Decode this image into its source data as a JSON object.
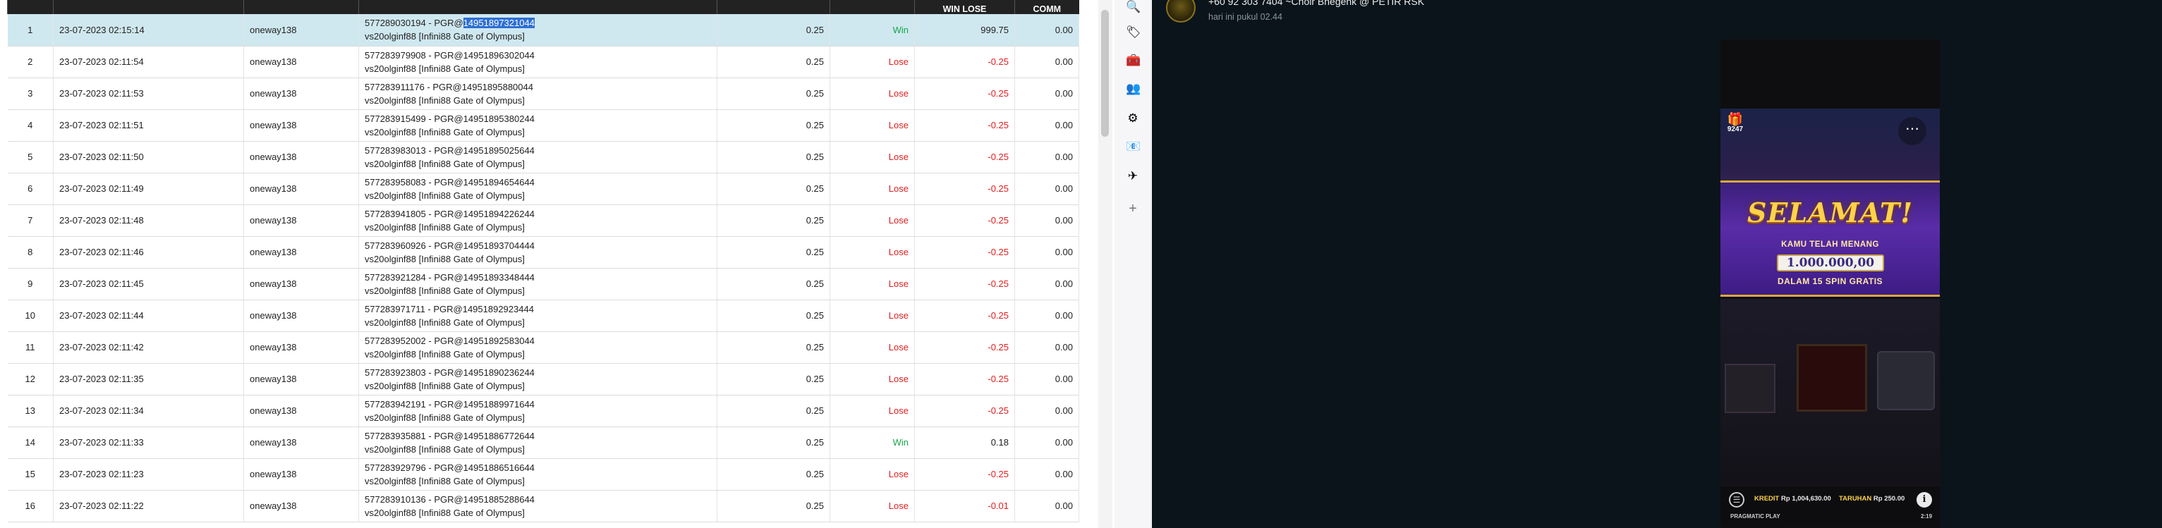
{
  "table": {
    "headers": [
      "",
      "",
      "",
      "",
      "",
      "",
      "WIN LOSE",
      "COMM"
    ],
    "rows": [
      {
        "no": "1",
        "date": "23-07-2023 02:15:14",
        "user": "oneway138",
        "detail_prefix": "577289030194 - PGR@",
        "detail_highlight": "14951897321044",
        "detail_line2": "vs20olginf88 [Infini88 Gate of Olympus]",
        "stake": "0.25",
        "status": "Win",
        "win_lose": "999.75",
        "comm": "0.00"
      },
      {
        "no": "2",
        "date": "23-07-2023 02:11:54",
        "user": "oneway138",
        "detail_prefix": "577283979908 - PGR@14951896302044",
        "detail_highlight": "",
        "detail_line2": "vs20olginf88 [Infini88 Gate of Olympus]",
        "stake": "0.25",
        "status": "Lose",
        "win_lose": "-0.25",
        "comm": "0.00"
      },
      {
        "no": "3",
        "date": "23-07-2023 02:11:53",
        "user": "oneway138",
        "detail_prefix": "577283911176 - PGR@14951895880044",
        "detail_highlight": "",
        "detail_line2": "vs20olginf88 [Infini88 Gate of Olympus]",
        "stake": "0.25",
        "status": "Lose",
        "win_lose": "-0.25",
        "comm": "0.00"
      },
      {
        "no": "4",
        "date": "23-07-2023 02:11:51",
        "user": "oneway138",
        "detail_prefix": "577283915499 - PGR@14951895380244",
        "detail_highlight": "",
        "detail_line2": "vs20olginf88 [Infini88 Gate of Olympus]",
        "stake": "0.25",
        "status": "Lose",
        "win_lose": "-0.25",
        "comm": "0.00"
      },
      {
        "no": "5",
        "date": "23-07-2023 02:11:50",
        "user": "oneway138",
        "detail_prefix": "577283983013 - PGR@14951895025644",
        "detail_highlight": "",
        "detail_line2": "vs20olginf88 [Infini88 Gate of Olympus]",
        "stake": "0.25",
        "status": "Lose",
        "win_lose": "-0.25",
        "comm": "0.00"
      },
      {
        "no": "6",
        "date": "23-07-2023 02:11:49",
        "user": "oneway138",
        "detail_prefix": "577283958083 - PGR@14951894654644",
        "detail_highlight": "",
        "detail_line2": "vs20olginf88 [Infini88 Gate of Olympus]",
        "stake": "0.25",
        "status": "Lose",
        "win_lose": "-0.25",
        "comm": "0.00"
      },
      {
        "no": "7",
        "date": "23-07-2023 02:11:48",
        "user": "oneway138",
        "detail_prefix": "577283941805 - PGR@14951894226244",
        "detail_highlight": "",
        "detail_line2": "vs20olginf88 [Infini88 Gate of Olympus]",
        "stake": "0.25",
        "status": "Lose",
        "win_lose": "-0.25",
        "comm": "0.00"
      },
      {
        "no": "8",
        "date": "23-07-2023 02:11:46",
        "user": "oneway138",
        "detail_prefix": "577283960926 - PGR@14951893704444",
        "detail_highlight": "",
        "detail_line2": "vs20olginf88 [Infini88 Gate of Olympus]",
        "stake": "0.25",
        "status": "Lose",
        "win_lose": "-0.25",
        "comm": "0.00"
      },
      {
        "no": "9",
        "date": "23-07-2023 02:11:45",
        "user": "oneway138",
        "detail_prefix": "577283921284 - PGR@14951893348444",
        "detail_highlight": "",
        "detail_line2": "vs20olginf88 [Infini88 Gate of Olympus]",
        "stake": "0.25",
        "status": "Lose",
        "win_lose": "-0.25",
        "comm": "0.00"
      },
      {
        "no": "10",
        "date": "23-07-2023 02:11:44",
        "user": "oneway138",
        "detail_prefix": "577283971711 - PGR@14951892923444",
        "detail_highlight": "",
        "detail_line2": "vs20olginf88 [Infini88 Gate of Olympus]",
        "stake": "0.25",
        "status": "Lose",
        "win_lose": "-0.25",
        "comm": "0.00"
      },
      {
        "no": "11",
        "date": "23-07-2023 02:11:42",
        "user": "oneway138",
        "detail_prefix": "577283952002 - PGR@14951892583044",
        "detail_highlight": "",
        "detail_line2": "vs20olginf88 [Infini88 Gate of Olympus]",
        "stake": "0.25",
        "status": "Lose",
        "win_lose": "-0.25",
        "comm": "0.00"
      },
      {
        "no": "12",
        "date": "23-07-2023 02:11:35",
        "user": "oneway138",
        "detail_prefix": "577283923803 - PGR@14951890236244",
        "detail_highlight": "",
        "detail_line2": "vs20olginf88 [Infini88 Gate of Olympus]",
        "stake": "0.25",
        "status": "Lose",
        "win_lose": "-0.25",
        "comm": "0.00"
      },
      {
        "no": "13",
        "date": "23-07-2023 02:11:34",
        "user": "oneway138",
        "detail_prefix": "577283942191 - PGR@14951889971644",
        "detail_highlight": "",
        "detail_line2": "vs20olginf88 [Infini88 Gate of Olympus]",
        "stake": "0.25",
        "status": "Lose",
        "win_lose": "-0.25",
        "comm": "0.00"
      },
      {
        "no": "14",
        "date": "23-07-2023 02:11:33",
        "user": "oneway138",
        "detail_prefix": "577283935881 - PGR@14951886772644",
        "detail_highlight": "",
        "detail_line2": "vs20olginf88 [Infini88 Gate of Olympus]",
        "stake": "0.25",
        "status": "Win",
        "win_lose": "0.18",
        "comm": "0.00"
      },
      {
        "no": "15",
        "date": "23-07-2023 02:11:23",
        "user": "oneway138",
        "detail_prefix": "577283929796 - PGR@14951886516644",
        "detail_highlight": "",
        "detail_line2": "vs20olginf88 [Infini88 Gate of Olympus]",
        "stake": "0.25",
        "status": "Lose",
        "win_lose": "-0.25",
        "comm": "0.00"
      },
      {
        "no": "16",
        "date": "23-07-2023 02:11:22",
        "user": "oneway138",
        "detail_prefix": "577283910136 - PGR@14951885288644",
        "detail_highlight": "",
        "detail_line2": "vs20olginf88 [Infini88 Gate of Olympus]",
        "stake": "0.25",
        "status": "Lose",
        "win_lose": "-0.01",
        "comm": "0.00"
      }
    ]
  },
  "sidebar_icons": [
    {
      "name": "search-icon",
      "glyph": "🔍"
    },
    {
      "name": "tag-icon",
      "glyph": "🏷"
    },
    {
      "name": "toolbox-icon",
      "glyph": "🧰"
    },
    {
      "name": "people-icon",
      "glyph": "👥"
    },
    {
      "name": "gear-icon",
      "glyph": "⚙"
    },
    {
      "name": "outlook-icon",
      "glyph": "📧"
    },
    {
      "name": "send-icon",
      "glyph": "✈"
    },
    {
      "name": "add-icon",
      "glyph": "+"
    }
  ],
  "chat": {
    "title": "+60 92 303 7404 ~Choir Bhegenk @ PETIR RSK",
    "subtitle": "hari ini pukul 02.44"
  },
  "game": {
    "gift_count": "9247",
    "banner_title": "SELAMAT!",
    "banner_subtitle": "KAMU TELAH MENANG",
    "win_amount": "1.000.000,00",
    "banner_footer": "DALAM 15 SPIN GRATIS",
    "credit_label": "KREDIT",
    "credit_value": "Rp 1,004,630.00",
    "bet_label": "TARUHAN",
    "bet_value": "Rp 250.00",
    "provider": "PRAGMATIC PLAY",
    "time": "2:19"
  },
  "colors": {
    "win": "#16a34a",
    "lose": "#e11d1d",
    "selected_row": "#cfe8ef",
    "header_bg": "#222222",
    "chat_bg": "#0b141a"
  }
}
